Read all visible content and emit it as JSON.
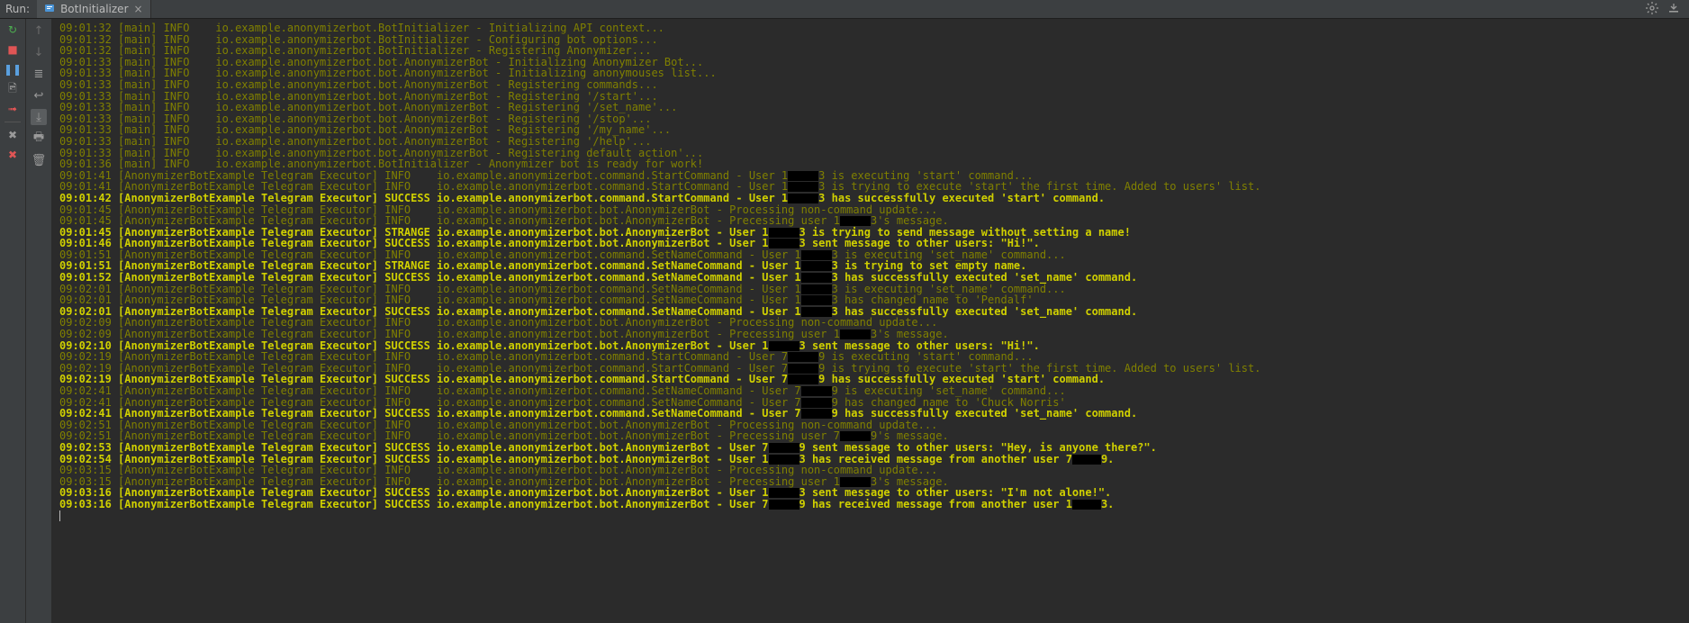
{
  "topbar": {
    "run_label": "Run:",
    "tab": {
      "title": "BotInitializer",
      "icon": "main-icon",
      "close": "×"
    },
    "right_icons": [
      "gear-icon",
      "minimize-icon"
    ]
  },
  "left_toolbar": [
    {
      "name": "rerun-icon",
      "glyph": "↻",
      "color": "#4caf50",
      "interactable": true
    },
    {
      "name": "stop-icon",
      "glyph": "■",
      "color": "#e05555",
      "interactable": true
    },
    {
      "name": "pause-icon",
      "glyph": "❚❚",
      "color": "#5aa0e0",
      "interactable": true
    },
    {
      "name": "dump-threads-icon",
      "glyph": "🖻",
      "color": "#9a9a9a",
      "interactable": true
    },
    {
      "name": "exit-icon",
      "glyph": "➟",
      "color": "#e05555",
      "interactable": true
    },
    {
      "name": "separator",
      "glyph": "",
      "color": "",
      "interactable": false
    },
    {
      "name": "close-tab-icon",
      "glyph": "✖",
      "color": "#9a9a9a",
      "interactable": true
    },
    {
      "name": "pin-icon",
      "glyph": "✖",
      "color": "#e05555",
      "interactable": true
    }
  ],
  "second_toolbar": [
    {
      "name": "arrow-up-icon",
      "glyph": "↑",
      "color": "#6b6b6b",
      "interactable": true
    },
    {
      "name": "arrow-down-icon",
      "glyph": "↓",
      "color": "#6b6b6b",
      "interactable": true
    },
    {
      "name": "layout-icon",
      "glyph": "≣",
      "color": "#9a9a9a",
      "interactable": true
    },
    {
      "name": "soft-wrap-icon",
      "glyph": "↩",
      "color": "#9a9a9a",
      "interactable": true
    },
    {
      "name": "scroll-to-end-icon",
      "glyph": "⤓",
      "color": "#9a9a9a",
      "interactable": true,
      "active": true
    },
    {
      "name": "print-icon",
      "glyph": "🖶",
      "color": "#9a9a9a",
      "interactable": true
    },
    {
      "name": "clear-icon",
      "glyph": "🗑",
      "color": "#9a9a9a",
      "interactable": true
    }
  ],
  "log": [
    {
      "time": "09:01:32",
      "thread": "[main]",
      "level": "INFO",
      "text": " io.example.anonymizerbot.BotInitializer - Initializing API context..."
    },
    {
      "time": "09:01:32",
      "thread": "[main]",
      "level": "INFO",
      "text": " io.example.anonymizerbot.BotInitializer - Configuring bot options..."
    },
    {
      "time": "09:01:32",
      "thread": "[main]",
      "level": "INFO",
      "text": " io.example.anonymizerbot.BotInitializer - Registering Anonymizer..."
    },
    {
      "time": "09:01:33",
      "thread": "[main]",
      "level": "INFO",
      "text": " io.example.anonymizerbot.bot.AnonymizerBot - Initializing Anonymizer Bot..."
    },
    {
      "time": "09:01:33",
      "thread": "[main]",
      "level": "INFO",
      "text": " io.example.anonymizerbot.bot.AnonymizerBot - Initializing anonymouses list..."
    },
    {
      "time": "09:01:33",
      "thread": "[main]",
      "level": "INFO",
      "text": " io.example.anonymizerbot.bot.AnonymizerBot - Registering commands..."
    },
    {
      "time": "09:01:33",
      "thread": "[main]",
      "level": "INFO",
      "text": " io.example.anonymizerbot.bot.AnonymizerBot - Registering '/start'..."
    },
    {
      "time": "09:01:33",
      "thread": "[main]",
      "level": "INFO",
      "text": " io.example.anonymizerbot.bot.AnonymizerBot - Registering '/set_name'..."
    },
    {
      "time": "09:01:33",
      "thread": "[main]",
      "level": "INFO",
      "text": " io.example.anonymizerbot.bot.AnonymizerBot - Registering '/stop'..."
    },
    {
      "time": "09:01:33",
      "thread": "[main]",
      "level": "INFO",
      "text": " io.example.anonymizerbot.bot.AnonymizerBot - Registering '/my_name'..."
    },
    {
      "time": "09:01:33",
      "thread": "[main]",
      "level": "INFO",
      "text": " io.example.anonymizerbot.bot.AnonymizerBot - Registering '/help'..."
    },
    {
      "time": "09:01:33",
      "thread": "[main]",
      "level": "INFO",
      "text": " io.example.anonymizerbot.bot.AnonymizerBot - Registering default action'..."
    },
    {
      "time": "09:01:36",
      "thread": "[main]",
      "level": "INFO",
      "text": " io.example.anonymizerbot.BotInitializer - Anonymizer bot is ready for work!"
    },
    {
      "time": "09:01:41",
      "thread": "[AnonymizerBotExample Telegram Executor]",
      "level": "INFO",
      "text": " io.example.anonymizerbot.command.StartCommand - ",
      "user": {
        "prefix": "User 1",
        "suffix": "3",
        "after": " is executing 'start' command..."
      }
    },
    {
      "time": "09:01:41",
      "thread": "[AnonymizerBotExample Telegram Executor]",
      "level": "INFO",
      "text": " io.example.anonymizerbot.command.StartCommand - ",
      "user": {
        "prefix": "User 1",
        "suffix": "3",
        "after": " is trying to execute 'start' the first time. Added to users' list."
      }
    },
    {
      "time": "09:01:42",
      "thread": "[AnonymizerBotExample Telegram Executor]",
      "level": "SUCCESS",
      "text": " io.example.anonymizerbot.command.StartCommand - ",
      "user": {
        "prefix": "User 1",
        "suffix": "3",
        "after": " has successfully executed 'start' command."
      }
    },
    {
      "time": "09:01:45",
      "thread": "[AnonymizerBotExample Telegram Executor]",
      "level": "INFO",
      "text": " io.example.anonymizerbot.bot.AnonymizerBot - Processing non-command update..."
    },
    {
      "time": "09:01:45",
      "thread": "[AnonymizerBotExample Telegram Executor]",
      "level": "INFO",
      "text": " io.example.anonymizerbot.bot.AnonymizerBot - ",
      "user": {
        "prefix": "Precessing user 1",
        "suffix": "3",
        "after": "'s message."
      }
    },
    {
      "time": "09:01:45",
      "thread": "[AnonymizerBotExample Telegram Executor]",
      "level": "STRANGE",
      "text": " io.example.anonymizerbot.bot.AnonymizerBot - ",
      "user": {
        "prefix": "User 1",
        "suffix": "3",
        "after": " is trying to send message without setting a name!"
      }
    },
    {
      "time": "09:01:46",
      "thread": "[AnonymizerBotExample Telegram Executor]",
      "level": "SUCCESS",
      "text": " io.example.anonymizerbot.bot.AnonymizerBot - ",
      "user": {
        "prefix": "User 1",
        "suffix": "3",
        "after": " sent message to other users: \"Hi!\"."
      }
    },
    {
      "time": "09:01:51",
      "thread": "[AnonymizerBotExample Telegram Executor]",
      "level": "INFO",
      "text": " io.example.anonymizerbot.command.SetNameCommand - ",
      "user": {
        "prefix": "User 1",
        "suffix": "3",
        "after": " is executing 'set_name' command..."
      }
    },
    {
      "time": "09:01:51",
      "thread": "[AnonymizerBotExample Telegram Executor]",
      "level": "STRANGE",
      "text": " io.example.anonymizerbot.command.SetNameCommand - ",
      "user": {
        "prefix": "User 1",
        "suffix": "3",
        "after": " is trying to set empty name."
      }
    },
    {
      "time": "09:01:52",
      "thread": "[AnonymizerBotExample Telegram Executor]",
      "level": "SUCCESS",
      "text": " io.example.anonymizerbot.command.SetNameCommand - ",
      "user": {
        "prefix": "User 1",
        "suffix": "3",
        "after": " has successfully executed 'set_name' command."
      }
    },
    {
      "time": "09:02:01",
      "thread": "[AnonymizerBotExample Telegram Executor]",
      "level": "INFO",
      "text": " io.example.anonymizerbot.command.SetNameCommand - ",
      "user": {
        "prefix": "User 1",
        "suffix": "3",
        "after": " is executing 'set_name' command..."
      }
    },
    {
      "time": "09:02:01",
      "thread": "[AnonymizerBotExample Telegram Executor]",
      "level": "INFO",
      "text": " io.example.anonymizerbot.command.SetNameCommand - ",
      "user": {
        "prefix": "User 1",
        "suffix": "3",
        "after": " has changed name to 'Pendalf'"
      }
    },
    {
      "time": "09:02:01",
      "thread": "[AnonymizerBotExample Telegram Executor]",
      "level": "SUCCESS",
      "text": " io.example.anonymizerbot.command.SetNameCommand - ",
      "user": {
        "prefix": "User 1",
        "suffix": "3",
        "after": " has successfully executed 'set_name' command."
      }
    },
    {
      "time": "09:02:09",
      "thread": "[AnonymizerBotExample Telegram Executor]",
      "level": "INFO",
      "text": " io.example.anonymizerbot.bot.AnonymizerBot - Processing non-command update..."
    },
    {
      "time": "09:02:09",
      "thread": "[AnonymizerBotExample Telegram Executor]",
      "level": "INFO",
      "text": " io.example.anonymizerbot.bot.AnonymizerBot - ",
      "user": {
        "prefix": "Precessing user 1",
        "suffix": "3",
        "after": "'s message."
      }
    },
    {
      "time": "09:02:10",
      "thread": "[AnonymizerBotExample Telegram Executor]",
      "level": "SUCCESS",
      "text": " io.example.anonymizerbot.bot.AnonymizerBot - ",
      "user": {
        "prefix": "User 1",
        "suffix": "3",
        "after": " sent message to other users: \"Hi!\"."
      }
    },
    {
      "time": "09:02:19",
      "thread": "[AnonymizerBotExample Telegram Executor]",
      "level": "INFO",
      "text": " io.example.anonymizerbot.command.StartCommand - ",
      "user": {
        "prefix": "User 7",
        "suffix": "9",
        "after": " is executing 'start' command..."
      }
    },
    {
      "time": "09:02:19",
      "thread": "[AnonymizerBotExample Telegram Executor]",
      "level": "INFO",
      "text": " io.example.anonymizerbot.command.StartCommand - ",
      "user": {
        "prefix": "User 7",
        "suffix": "9",
        "after": " is trying to execute 'start' the first time. Added to users' list."
      }
    },
    {
      "time": "09:02:19",
      "thread": "[AnonymizerBotExample Telegram Executor]",
      "level": "SUCCESS",
      "text": " io.example.anonymizerbot.command.StartCommand - ",
      "user": {
        "prefix": "User 7",
        "suffix": "9",
        "after": " has successfully executed 'start' command."
      }
    },
    {
      "time": "09:02:41",
      "thread": "[AnonymizerBotExample Telegram Executor]",
      "level": "INFO",
      "text": " io.example.anonymizerbot.command.SetNameCommand - ",
      "user": {
        "prefix": "User 7",
        "suffix": "9",
        "after": " is executing 'set_name' command..."
      }
    },
    {
      "time": "09:02:41",
      "thread": "[AnonymizerBotExample Telegram Executor]",
      "level": "INFO",
      "text": " io.example.anonymizerbot.command.SetNameCommand - ",
      "user": {
        "prefix": "User 7",
        "suffix": "9",
        "after": " has changed name to 'Chuck Norris'"
      }
    },
    {
      "time": "09:02:41",
      "thread": "[AnonymizerBotExample Telegram Executor]",
      "level": "SUCCESS",
      "text": " io.example.anonymizerbot.command.SetNameCommand - ",
      "user": {
        "prefix": "User 7",
        "suffix": "9",
        "after": " has successfully executed 'set_name' command."
      }
    },
    {
      "time": "09:02:51",
      "thread": "[AnonymizerBotExample Telegram Executor]",
      "level": "INFO",
      "text": " io.example.anonymizerbot.bot.AnonymizerBot - Processing non-command update..."
    },
    {
      "time": "09:02:51",
      "thread": "[AnonymizerBotExample Telegram Executor]",
      "level": "INFO",
      "text": " io.example.anonymizerbot.bot.AnonymizerBot - ",
      "user": {
        "prefix": "Precessing user 7",
        "suffix": "9",
        "after": "'s message."
      }
    },
    {
      "time": "09:02:53",
      "thread": "[AnonymizerBotExample Telegram Executor]",
      "level": "SUCCESS",
      "text": " io.example.anonymizerbot.bot.AnonymizerBot - ",
      "user": {
        "prefix": "User 7",
        "suffix": "9",
        "after": " sent message to other users: \"Hey, is anyone there?\"."
      }
    },
    {
      "time": "09:02:54",
      "thread": "[AnonymizerBotExample Telegram Executor]",
      "level": "SUCCESS",
      "text": " io.example.anonymizerbot.bot.AnonymizerBot - ",
      "user": {
        "prefix": "User 1",
        "suffix": "3",
        "after": " has received message from another user 7"
      },
      "user2": {
        "suffix": "9",
        "after": "."
      }
    },
    {
      "time": "09:03:15",
      "thread": "[AnonymizerBotExample Telegram Executor]",
      "level": "INFO",
      "text": " io.example.anonymizerbot.bot.AnonymizerBot - Processing non-command update..."
    },
    {
      "time": "09:03:15",
      "thread": "[AnonymizerBotExample Telegram Executor]",
      "level": "INFO",
      "text": " io.example.anonymizerbot.bot.AnonymizerBot - ",
      "user": {
        "prefix": "Precessing user 1",
        "suffix": "3",
        "after": "'s message."
      }
    },
    {
      "time": "09:03:16",
      "thread": "[AnonymizerBotExample Telegram Executor]",
      "level": "SUCCESS",
      "text": " io.example.anonymizerbot.bot.AnonymizerBot - ",
      "user": {
        "prefix": "User 1",
        "suffix": "3",
        "after": " sent message to other users: \"I'm not alone!\"."
      }
    },
    {
      "time": "09:03:16",
      "thread": "[AnonymizerBotExample Telegram Executor]",
      "level": "SUCCESS",
      "text": " io.example.anonymizerbot.bot.AnonymizerBot - ",
      "user": {
        "prefix": "User 7",
        "suffix": "9",
        "after": " has received message from another user 1"
      },
      "user2": {
        "suffix": "3",
        "after": "."
      }
    }
  ]
}
